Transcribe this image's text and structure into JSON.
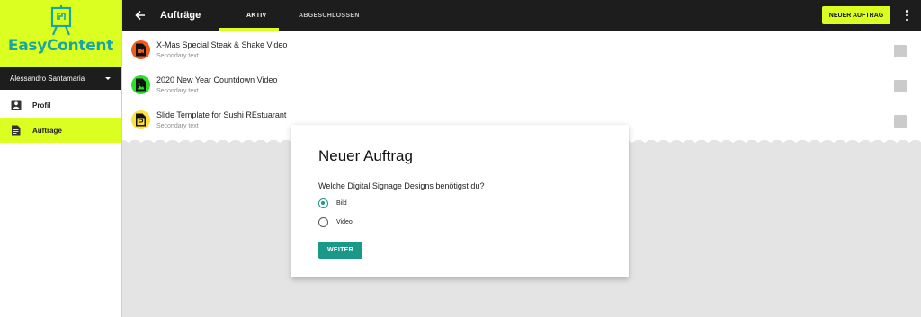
{
  "app": {
    "name": "EasyContent",
    "brand_color": "#dcff22",
    "accent_color": "#1a9988"
  },
  "sidebar": {
    "user_name": "Alessandro Santamaria",
    "items": [
      {
        "label": "Profil",
        "icon": "person-icon",
        "active": false
      },
      {
        "label": "Aufträge",
        "icon": "document-icon",
        "active": true
      }
    ]
  },
  "topbar": {
    "title": "Aufträge",
    "tabs": [
      {
        "label": "AKTIV",
        "active": true
      },
      {
        "label": "ABGESCHLOSSEN",
        "active": false
      }
    ],
    "new_button": "NEUER AUFTRAG"
  },
  "list": {
    "items": [
      {
        "title": "X-Mas Special Steak & Shake Video",
        "subtitle": "Secondary text",
        "icon": "video-icon",
        "color": "#f05a1e"
      },
      {
        "title": "2020 New Year Countdown Video",
        "subtitle": "Secondary text",
        "icon": "image-icon",
        "color": "#28e028"
      },
      {
        "title": "Slide Template for Sushi REstuarant",
        "subtitle": "Secondary text",
        "icon": "powerpoint-icon",
        "color": "#ffdf3b"
      }
    ]
  },
  "dialog": {
    "title": "Neuer Auftrag",
    "question": "Welche Digital Signage Designs benötigst du?",
    "options": [
      {
        "label": "Bild",
        "checked": true
      },
      {
        "label": "Video",
        "checked": false
      }
    ],
    "submit": "WEITER"
  }
}
